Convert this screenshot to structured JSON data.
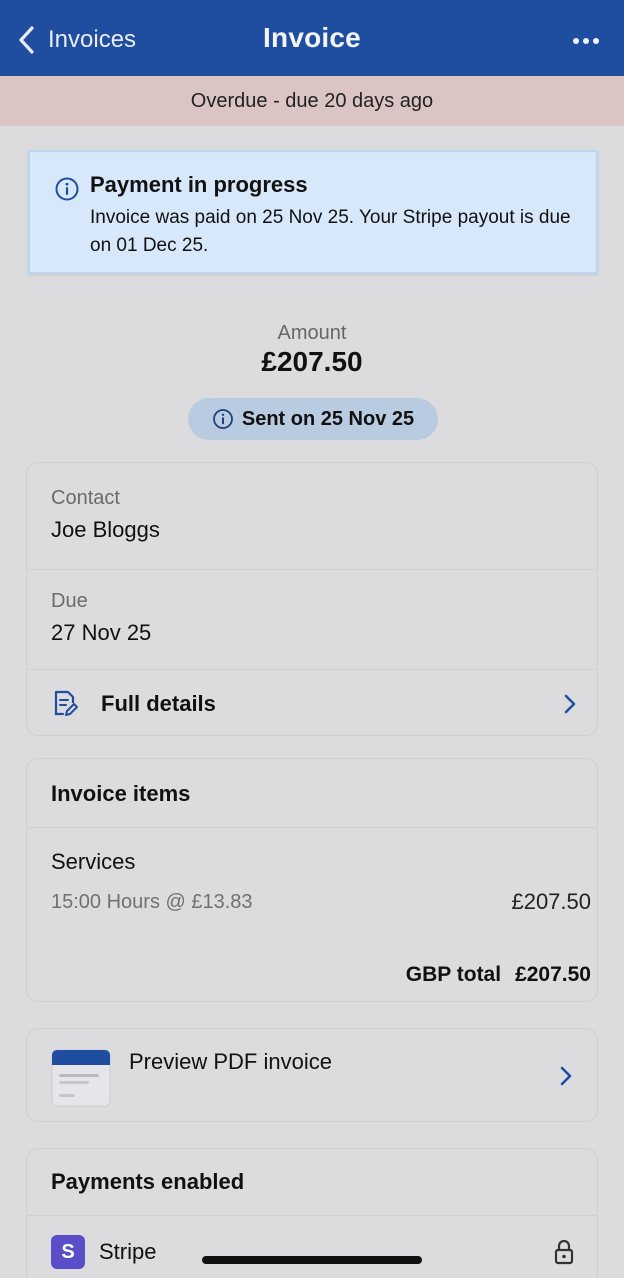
{
  "nav": {
    "back_label": "Invoices",
    "title": "Invoice"
  },
  "status_banner": {
    "text": "Overdue - due 20 days ago"
  },
  "alert": {
    "title": "Payment in progress",
    "body": "Invoice was paid on 25 Nov 25. Your Stripe payout is due on 01 Dec 25."
  },
  "amount": {
    "label": "Amount",
    "value": "£207.50",
    "sent_label": "Sent on 25 Nov 25"
  },
  "details": {
    "contact_label": "Contact",
    "contact_value": "Joe Bloggs",
    "due_label": "Due",
    "due_value": "27 Nov 25",
    "full_details_label": "Full details"
  },
  "invoice_items": {
    "title": "Invoice items",
    "items": [
      {
        "name": "Services",
        "detail": "15:00 Hours @ £13.83",
        "amount": "£207.50"
      }
    ],
    "total_label": "GBP total",
    "total_value": "£207.50"
  },
  "pdf": {
    "label": "Preview PDF invoice"
  },
  "payments": {
    "title": "Payments enabled",
    "providers": [
      {
        "name": "Stripe",
        "badge": "S"
      }
    ]
  },
  "colors": {
    "nav_bg": "#1f4ea0",
    "overdue_bg": "#dbc4c4",
    "alert_bg": "#d7e8fb",
    "pill_bg": "#b8cbe0",
    "accent": "#1f4ea0",
    "stripe": "#5b4fc9"
  }
}
